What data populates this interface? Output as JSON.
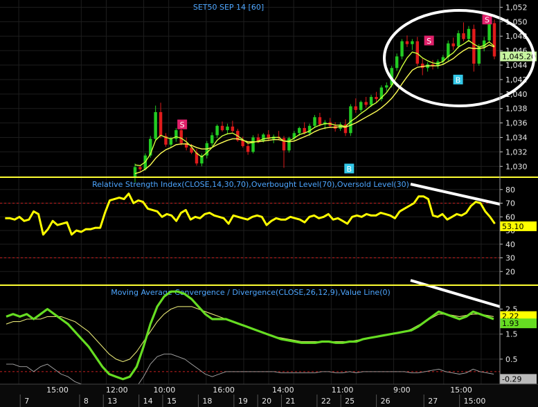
{
  "chart_data": [
    {
      "type": "candlestick",
      "title": "SET50 SEP 14   [60]",
      "ylim": [
        1028.5,
        1053
      ],
      "y_ticks": [
        "1,052",
        "1,050",
        "1,048",
        "1,046",
        "1,044",
        "1,042",
        "1,040",
        "1,038",
        "1,036",
        "1,034",
        "1,032",
        "1,030"
      ],
      "last_price": "1,045.20",
      "candles": [
        [
          1028.6,
          1030.4,
          1027.8,
          1029.9
        ],
        [
          1029.9,
          1030.1,
          1029.3,
          1029.6
        ],
        [
          1029.6,
          1031.8,
          1029.4,
          1031.5
        ],
        [
          1031.5,
          1034.2,
          1031.2,
          1033.8
        ],
        [
          1033.8,
          1038.4,
          1033.5,
          1037.5
        ],
        [
          1037.5,
          1038.8,
          1033.9,
          1034.2
        ],
        [
          1034.2,
          1034.6,
          1032.7,
          1033.0
        ],
        [
          1033.0,
          1034.1,
          1032.6,
          1033.8
        ],
        [
          1033.8,
          1035.3,
          1033.4,
          1035.0
        ],
        [
          1035.0,
          1035.6,
          1032.9,
          1033.2
        ],
        [
          1033.2,
          1034.0,
          1032.2,
          1032.6
        ],
        [
          1032.6,
          1033.1,
          1031.7,
          1031.9
        ],
        [
          1031.9,
          1032.4,
          1030.1,
          1030.4
        ],
        [
          1030.4,
          1031.8,
          1030.0,
          1031.5
        ],
        [
          1031.5,
          1033.5,
          1031.1,
          1033.2
        ],
        [
          1033.2,
          1034.7,
          1032.8,
          1034.3
        ],
        [
          1034.3,
          1035.8,
          1033.9,
          1035.6
        ],
        [
          1035.6,
          1036.2,
          1034.8,
          1035.0
        ],
        [
          1035.0,
          1035.9,
          1034.4,
          1035.5
        ],
        [
          1035.5,
          1036.3,
          1034.7,
          1034.9
        ],
        [
          1034.9,
          1035.2,
          1033.4,
          1033.6
        ],
        [
          1033.6,
          1034.1,
          1032.6,
          1032.8
        ],
        [
          1032.8,
          1033.3,
          1031.6,
          1032.0
        ],
        [
          1032.0,
          1034.3,
          1031.8,
          1034.0
        ],
        [
          1034.0,
          1034.5,
          1033.2,
          1033.5
        ],
        [
          1033.5,
          1034.6,
          1033.3,
          1034.4
        ],
        [
          1034.4,
          1035.0,
          1033.5,
          1033.8
        ],
        [
          1033.8,
          1034.4,
          1033.2,
          1034.1
        ],
        [
          1034.1,
          1034.9,
          1033.6,
          1033.9
        ],
        [
          1033.9,
          1034.2,
          1029.8,
          1032.2
        ],
        [
          1032.2,
          1034.1,
          1031.9,
          1033.9
        ],
        [
          1033.9,
          1034.9,
          1033.5,
          1034.6
        ],
        [
          1034.6,
          1035.5,
          1034.2,
          1035.3
        ],
        [
          1035.3,
          1036.1,
          1034.4,
          1034.6
        ],
        [
          1034.6,
          1035.9,
          1034.2,
          1035.6
        ],
        [
          1035.6,
          1037.1,
          1035.3,
          1036.8
        ],
        [
          1036.8,
          1037.4,
          1035.5,
          1035.8
        ],
        [
          1035.8,
          1036.4,
          1035.1,
          1036.1
        ],
        [
          1036.1,
          1036.7,
          1035.3,
          1035.6
        ],
        [
          1035.6,
          1036.1,
          1034.8,
          1035.2
        ],
        [
          1035.2,
          1036.1,
          1034.9,
          1035.8
        ],
        [
          1035.8,
          1036.5,
          1034.2,
          1034.6
        ],
        [
          1034.6,
          1038.6,
          1034.2,
          1038.3
        ],
        [
          1038.3,
          1039.4,
          1037.4,
          1037.8
        ],
        [
          1037.8,
          1039.1,
          1037.5,
          1038.9
        ],
        [
          1038.9,
          1039.6,
          1038.1,
          1038.5
        ],
        [
          1038.5,
          1039.9,
          1038.2,
          1039.6
        ],
        [
          1039.6,
          1040.3,
          1038.9,
          1039.3
        ],
        [
          1039.3,
          1041.2,
          1039.0,
          1040.9
        ],
        [
          1040.9,
          1041.6,
          1040.4,
          1041.2
        ],
        [
          1041.2,
          1043.9,
          1040.9,
          1043.6
        ],
        [
          1043.6,
          1045.6,
          1043.2,
          1045.2
        ],
        [
          1045.2,
          1047.6,
          1044.8,
          1047.3
        ],
        [
          1047.3,
          1048.1,
          1046.5,
          1046.9
        ],
        [
          1046.9,
          1047.6,
          1046.1,
          1047.3
        ],
        [
          1047.3,
          1047.9,
          1043.9,
          1044.2
        ],
        [
          1044.2,
          1044.9,
          1042.6,
          1043.6
        ],
        [
          1043.6,
          1044.4,
          1043.1,
          1044.1
        ],
        [
          1044.1,
          1044.7,
          1043.4,
          1043.9
        ],
        [
          1043.9,
          1044.8,
          1043.5,
          1044.5
        ],
        [
          1044.5,
          1045.4,
          1044.0,
          1045.1
        ],
        [
          1045.1,
          1047.4,
          1044.6,
          1047.0
        ],
        [
          1047.0,
          1047.8,
          1046.1,
          1046.6
        ],
        [
          1046.6,
          1048.8,
          1046.3,
          1048.4
        ],
        [
          1048.4,
          1049.9,
          1047.3,
          1047.6
        ],
        [
          1047.6,
          1049.4,
          1047.2,
          1049.0
        ],
        [
          1049.0,
          1049.6,
          1043.1,
          1044.2
        ],
        [
          1044.2,
          1046.9,
          1043.9,
          1046.5
        ],
        [
          1046.5,
          1047.9,
          1045.9,
          1047.4
        ],
        [
          1047.4,
          1050.4,
          1047.1,
          1049.8
        ],
        [
          1049.8,
          1050.3,
          1044.8,
          1045.2
        ]
      ],
      "ma_fast": [
        1030.2,
        1030.1,
        1030.6,
        1031.7,
        1033.6,
        1034.3,
        1034.0,
        1033.8,
        1034.1,
        1033.9,
        1033.4,
        1032.7,
        1031.8,
        1031.3,
        1031.9,
        1032.6,
        1033.6,
        1034.2,
        1034.5,
        1034.6,
        1034.2,
        1033.7,
        1033.2,
        1033.3,
        1033.5,
        1033.8,
        1033.9,
        1034.0,
        1034.0,
        1033.5,
        1033.5,
        1033.9,
        1034.4,
        1034.6,
        1034.9,
        1035.4,
        1035.7,
        1035.9,
        1035.9,
        1035.7,
        1035.7,
        1035.5,
        1036.2,
        1036.7,
        1037.3,
        1037.8,
        1038.4,
        1038.8,
        1039.5,
        1040.2,
        1041.2,
        1042.4,
        1043.8,
        1045.0,
        1045.8,
        1045.6,
        1045.0,
        1044.6,
        1044.3,
        1044.2,
        1044.5,
        1045.2,
        1045.7,
        1046.5,
        1046.9,
        1047.4,
        1046.9,
        1046.5,
        1046.7,
        1047.2,
        1046.6
      ],
      "ma_slow": [
        1029.0,
        1029.2,
        1029.6,
        1030.2,
        1031.1,
        1031.8,
        1032.3,
        1032.6,
        1033.0,
        1033.1,
        1033.1,
        1032.9,
        1032.6,
        1032.4,
        1032.4,
        1032.6,
        1033.0,
        1033.3,
        1033.6,
        1033.8,
        1033.8,
        1033.6,
        1033.4,
        1033.4,
        1033.4,
        1033.5,
        1033.6,
        1033.7,
        1033.7,
        1033.5,
        1033.4,
        1033.5,
        1033.8,
        1034.1,
        1034.4,
        1034.8,
        1035.1,
        1035.3,
        1035.4,
        1035.4,
        1035.5,
        1035.4,
        1035.7,
        1036.0,
        1036.4,
        1036.8,
        1037.2,
        1037.6,
        1038.1,
        1038.7,
        1039.4,
        1040.3,
        1041.4,
        1042.4,
        1043.3,
        1043.7,
        1043.8,
        1043.9,
        1043.9,
        1043.9,
        1044.1,
        1044.5,
        1044.9,
        1045.5,
        1046.0,
        1046.4,
        1046.3,
        1046.3,
        1046.4,
        1046.8,
        1046.5
      ],
      "signals": [
        {
          "label": "S",
          "index": 13,
          "value": 1035.8
        },
        {
          "label": "B",
          "index": 59,
          "value": 1029.7
        },
        {
          "label": "S",
          "index": 81,
          "value": 1047.4
        },
        {
          "label": "B",
          "index": 89,
          "value": 1042.0
        },
        {
          "label": "S",
          "index": 97,
          "value": 1050.3
        }
      ]
    },
    {
      "type": "line",
      "title": "Relative Strength Index(CLOSE,14,30,70),Overbought Level(70),Oversold Level(30)",
      "ylim": [
        10,
        88
      ],
      "y_ticks": [
        "80",
        "70",
        "60",
        "50",
        "40",
        "30",
        "20"
      ],
      "levels": [
        70,
        30
      ],
      "last_value": "53.10",
      "values": [
        59,
        59,
        58,
        60,
        57,
        58,
        64,
        62,
        47,
        51,
        57,
        54,
        55,
        56,
        47,
        50,
        49,
        51,
        51,
        52,
        52,
        63,
        72,
        73,
        74,
        73,
        77,
        70,
        72,
        71,
        66,
        65,
        64,
        60,
        62,
        61,
        57,
        63,
        65,
        58,
        60,
        59,
        62,
        63,
        61,
        60,
        59,
        55,
        61,
        60,
        59,
        58,
        60,
        61,
        60,
        54,
        57,
        59,
        58,
        58,
        60,
        59,
        58,
        56,
        60,
        61,
        59,
        60,
        62,
        58,
        59,
        57,
        55,
        60,
        61,
        60,
        62,
        61,
        61,
        63,
        62,
        61,
        59,
        64,
        66,
        68,
        70,
        75,
        75,
        73,
        61,
        60,
        62,
        58,
        60,
        62,
        61,
        63,
        68,
        71,
        70,
        64,
        60,
        55
      ]
    },
    {
      "type": "line",
      "title": "Moving Average Convergence / Divergence(CLOSE,26,12,9),Value Line(0)",
      "ylim": [
        -0.5,
        3.4
      ],
      "y_ticks": [
        "2.5",
        "1.5",
        "0.5"
      ],
      "levels": [
        0
      ],
      "series": [
        {
          "name": "MACD",
          "last_value": "2.22",
          "values": [
            2.2,
            2.3,
            2.2,
            2.3,
            2.1,
            2.3,
            2.5,
            2.3,
            2.1,
            1.9,
            1.6,
            1.3,
            1.0,
            0.6,
            0.2,
            -0.1,
            -0.2,
            -0.3,
            -0.2,
            0.2,
            1.0,
            1.9,
            2.6,
            3.0,
            3.2,
            3.2,
            3.1,
            2.9,
            2.6,
            2.3,
            2.1,
            2.1,
            2.1,
            2.0,
            1.9,
            1.8,
            1.7,
            1.6,
            1.5,
            1.4,
            1.3,
            1.25,
            1.2,
            1.15,
            1.15,
            1.15,
            1.2,
            1.2,
            1.15,
            1.15,
            1.2,
            1.2,
            1.3,
            1.35,
            1.4,
            1.45,
            1.5,
            1.55,
            1.6,
            1.65,
            1.8,
            2.0,
            2.2,
            2.4,
            2.3,
            2.2,
            2.1,
            2.2,
            2.4,
            2.3,
            2.2,
            2.1
          ]
        },
        {
          "name": "Signal",
          "last_value": "1.93",
          "values": [
            1.9,
            2.0,
            2.0,
            2.1,
            2.1,
            2.1,
            2.2,
            2.2,
            2.2,
            2.1,
            2.0,
            1.8,
            1.6,
            1.3,
            1.0,
            0.7,
            0.5,
            0.4,
            0.5,
            0.8,
            1.2,
            1.6,
            2.0,
            2.3,
            2.5,
            2.6,
            2.6,
            2.6,
            2.5,
            2.4,
            2.3,
            2.2,
            2.1,
            2.0,
            1.9,
            1.8,
            1.7,
            1.6,
            1.5,
            1.4,
            1.35,
            1.3,
            1.25,
            1.2,
            1.2,
            1.2,
            1.2,
            1.2,
            1.2,
            1.2,
            1.2,
            1.25,
            1.3,
            1.35,
            1.4,
            1.45,
            1.5,
            1.55,
            1.6,
            1.7,
            1.85,
            2.0,
            2.15,
            2.3,
            2.3,
            2.25,
            2.2,
            2.25,
            2.3,
            2.3,
            2.25,
            2.2
          ]
        },
        {
          "name": "Histogram",
          "last_value": "-0.29",
          "values": [
            0.3,
            0.3,
            0.2,
            0.2,
            0.0,
            0.2,
            0.3,
            0.1,
            -0.1,
            -0.2,
            -0.4,
            -0.5,
            -0.6,
            -0.7,
            -0.8,
            -0.8,
            -0.7,
            -0.7,
            -0.7,
            -0.6,
            -0.2,
            0.3,
            0.6,
            0.7,
            0.7,
            0.6,
            0.5,
            0.3,
            0.1,
            -0.1,
            -0.2,
            -0.1,
            0.0,
            0.0,
            0.0,
            0.0,
            0.0,
            0.0,
            0.0,
            0.0,
            -0.05,
            -0.05,
            -0.05,
            -0.05,
            -0.05,
            -0.05,
            0.0,
            0.0,
            -0.05,
            -0.05,
            0.0,
            -0.05,
            0.0,
            0.0,
            0.0,
            0.0,
            0.0,
            0.0,
            0.0,
            -0.05,
            -0.05,
            0.0,
            0.05,
            0.1,
            0.0,
            -0.05,
            -0.1,
            -0.05,
            0.1,
            0.0,
            -0.05,
            -0.1
          ]
        }
      ]
    }
  ],
  "x_axis": {
    "time_labels": [
      {
        "label": "15:00",
        "index": 4
      },
      {
        "label": "12:00",
        "index": 9
      },
      {
        "label": "10:00",
        "index": 13
      },
      {
        "label": "16:00",
        "index": 18
      },
      {
        "label": "14:00",
        "index": 23
      },
      {
        "label": "11:00",
        "index": 28
      },
      {
        "label": "9:00",
        "index": 33
      },
      {
        "label": "15:00",
        "index": 38
      }
    ],
    "date_labels": [
      {
        "label": "7",
        "index": 1
      },
      {
        "label": "8",
        "index": 6
      },
      {
        "label": "13",
        "index": 8
      },
      {
        "label": "14",
        "index": 11
      },
      {
        "label": "15",
        "index": 13
      },
      {
        "label": "18",
        "index": 16
      },
      {
        "label": "19",
        "index": 19
      },
      {
        "label": "20",
        "index": 21
      },
      {
        "label": "21",
        "index": 23
      },
      {
        "label": "22",
        "index": 26
      },
      {
        "label": "25",
        "index": 28
      },
      {
        "label": "26",
        "index": 31
      },
      {
        "label": "27",
        "index": 35
      },
      {
        "label": "15:00",
        "index": 38
      }
    ]
  },
  "colors": {
    "background": "#000000",
    "up": "#22cc22",
    "down": "#e01b1b",
    "ma_fast": "#cfff3a",
    "ma_slow": "#ffff55",
    "rsi": "#ffff00",
    "macd": "#66dd22",
    "signal": "#e6e675",
    "hist": "#aaaaaa",
    "grid": "#1e1e1e",
    "levels": "#cc2222",
    "separator": "#ffff33",
    "panel_title": "#4da6ff",
    "sell_marker": "#e0206a",
    "buy_marker": "#33c8e8"
  }
}
